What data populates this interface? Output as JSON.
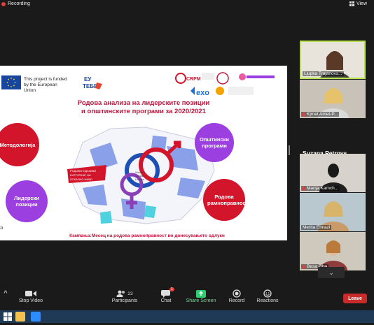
{
  "topbar": {
    "recording_label": "Recording",
    "view_label": "View"
  },
  "slide": {
    "eu_funding_text": "This project is funded by the European Union",
    "title_line1": "Родова анализа на лидерските позиции",
    "title_line2": "и општинските програми за 2020/2021",
    "bubbles": {
      "methodology": "Методологија",
      "municipal_programs": "Општински програми",
      "leadership_positions": "Лидерски позиции",
      "gender_equality": "Родова рамноправност"
    },
    "banner_text": "РОДОВО ЕДНАКВИ КУЛТУРАЛЕ НА ЛОКАЛНО НИВО",
    "campaign_text": "Кампања:Месец на родова рамноправност во донесувањето одлуки",
    "side_label": "zi",
    "colors": {
      "title": "#c0143c",
      "bubble_red": "#d3152b",
      "bubble_purple": "#9b3fe0",
      "map_blue": "#8aa0e8"
    }
  },
  "participants": [
    {
      "name": "Ljupka Trajanovs...",
      "active": true
    },
    {
      "name": "Kjmet Amet-P...",
      "muted": true
    },
    {
      "name": "Suzana  Petrovs..."
    },
    {
      "name": "Marija Kamch...",
      "muted": true
    },
    {
      "name": "Merita Elmazi"
    },
    {
      "name": "Besa Ziba",
      "muted": true
    }
  ],
  "toolbar": {
    "stop_video": "Stop Video",
    "participants": "Participants",
    "participants_count": "23",
    "chat": "Chat",
    "chat_badge": "1",
    "share_screen": "Share Screen",
    "record": "Record",
    "reactions": "Reactions",
    "leave": "Leave"
  }
}
